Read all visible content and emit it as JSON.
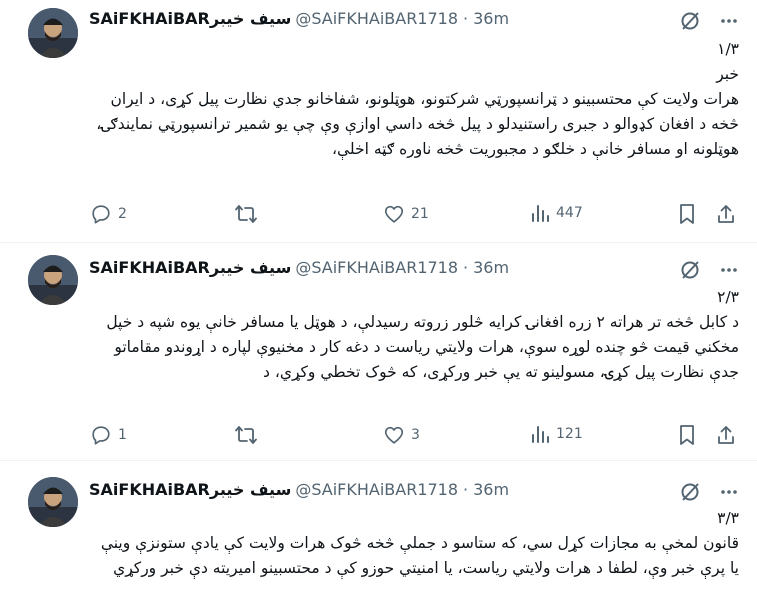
{
  "tweets": [
    {
      "name": "SAiFKHAiBARسيف خيبر",
      "handle": "@SAiFKHAiBAR1718",
      "dot": "·",
      "time": "36m",
      "lines": [
        "۱/۳",
        "خبر",
        "هرات ولایت کې محتسبینو د ټرانسپورټي شرکتونو، هوټلونو، شفاخانو جدي نظارت پیل کړی، د ایران څخه د افغان کډوالو د جبری راستنیدلو د پیل څخه داسي اوازې وې چې یو شمیر ترانسپورټي نمایندګۍ، هوټلونه او مسافر خانې د خلګو د مجبوریت څخه ناوره ګټه اخلې،"
      ],
      "replies": "2",
      "reposts": "",
      "likes": "21",
      "views": "447"
    },
    {
      "name": "SAiFKHAiBARسيف خيبر",
      "handle": "@SAiFKHAiBAR1718",
      "dot": "·",
      "time": "36m",
      "lines": [
        "۲/۳",
        "د کابل څخه تر هراته ۲ زره افغانۍ کرایه څلور زروته رسیدلې، د هوټل یا مسافر خانې یوه شپه د خپل مخکني قیمت څو چنده لوړه سوې، هرات ولایتي ریاست د دغه کار د مخنیوې لپاره د اړوندو مقاماتو جدې نظارت پیل کړۍ، مسولینو ته یې خبر ورکړی، که څوک تخطي وکړي، د"
      ],
      "replies": "1",
      "reposts": "",
      "likes": "3",
      "views": "121"
    },
    {
      "name": "SAiFKHAiBARسيف خيبر",
      "handle": "@SAiFKHAiBAR1718",
      "dot": "·",
      "time": "36m",
      "lines": [
        "۳/۳",
        "قانون لمخې به مجازات کړل سي، که ستاسو د جملې څخه څوک  هرات ولایت کې یادې ستونزې وینې یا پرې خبر وې، لطفا د هرات ولایتي ریاست، یا امنیتي حوزو کې د محتسبینو امیریته دې خبر ورکړي"
      ]
    }
  ],
  "icons": {
    "grok": "grok-icon",
    "more": "more-icon",
    "reply": "reply-icon",
    "repost": "repost-icon",
    "like": "like-icon",
    "views": "views-icon",
    "bookmark": "bookmark-icon",
    "share": "share-icon"
  },
  "colors": {
    "text": "#0f1419",
    "secondary": "#536471",
    "divider": "#eff3f4"
  }
}
